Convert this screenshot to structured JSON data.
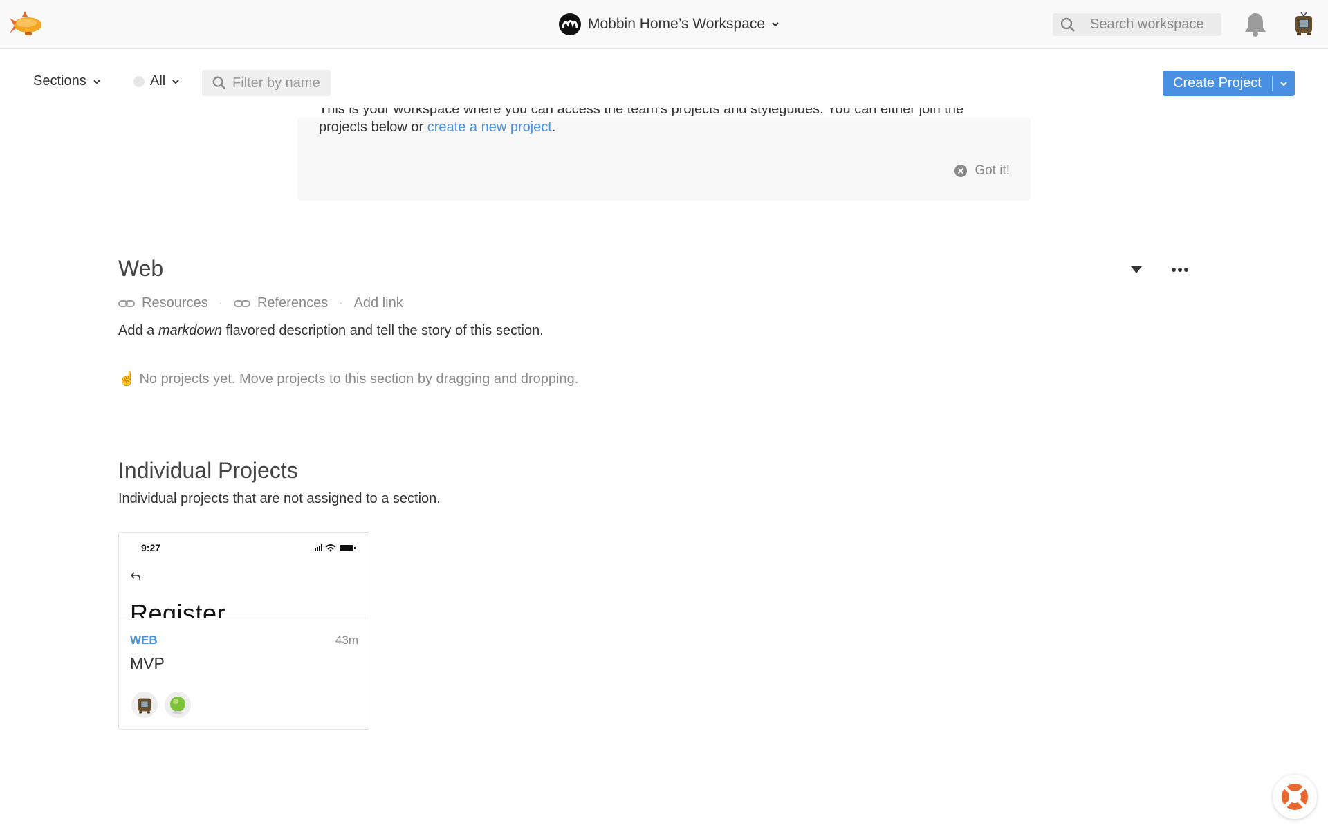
{
  "header": {
    "workspace_name": "Mobbin Home’s Workspace",
    "search_placeholder": "Search workspace"
  },
  "toolbar": {
    "sections_label": "Sections",
    "filter_all_label": "All",
    "filter_placeholder": "Filter by name",
    "create_button_label": "Create Project"
  },
  "banner": {
    "line1": "This is your workspace where you can access the team's projects and styleguides. You can either join the",
    "line2_prefix": "projects below or ",
    "line2_link": "create a new project",
    "line2_suffix": ".",
    "dismiss_label": "Got it!"
  },
  "web_section": {
    "title": "Web",
    "links": [
      "Resources",
      "References"
    ],
    "add_link_label": "Add link",
    "description_prefix": "Add a ",
    "description_emphasis": "markdown",
    "description_suffix": " flavored description and tell the story of this section.",
    "empty_icon": "☝",
    "empty_text": " No projects yet. Move projects to this section by dragging and dropping."
  },
  "individual_projects": {
    "title": "Individual Projects",
    "description": "Individual projects that are not assigned to a section.",
    "projects": [
      {
        "thumb_time": "9:27",
        "thumb_heading": "Register",
        "tag": "WEB",
        "updated": "43m",
        "name": "MVP"
      }
    ]
  },
  "colors": {
    "accent": "#4a90e2",
    "topbar_bg": "#f9f9f9",
    "help_orange": "#e8692e"
  },
  "icons": [
    "zeppelin-logo-icon",
    "search-icon",
    "bell-icon",
    "user-avatar",
    "chevron-down-icon",
    "link-icon",
    "close-circle-icon",
    "caret-down-icon",
    "more-icon",
    "help-lifebuoy-icon"
  ]
}
